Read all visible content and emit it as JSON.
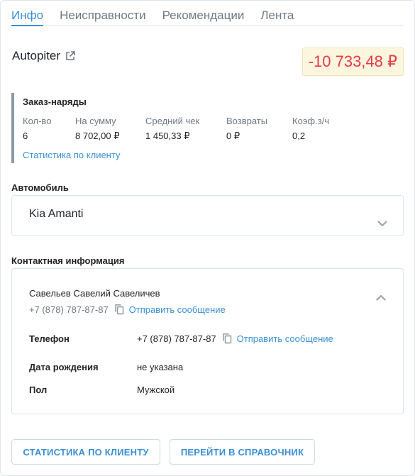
{
  "tabs": [
    {
      "label": "Инфо"
    },
    {
      "label": "Неисправности"
    },
    {
      "label": "Рекомендации"
    },
    {
      "label": "Лента"
    }
  ],
  "client": {
    "name": "Autopiter",
    "balance": "-10 733,48 ₽"
  },
  "orders": {
    "title": "Заказ-наряды",
    "stats": [
      {
        "label": "Кол-во",
        "value": "6"
      },
      {
        "label": "На сумму",
        "value": "8 702,00 ₽"
      },
      {
        "label": "Средний чек",
        "value": "1 450,33 ₽"
      },
      {
        "label": "Возвраты",
        "value": "0 ₽"
      },
      {
        "label": "Коэф.з/ч",
        "value": "0,2"
      }
    ],
    "stats_link": "Статистика по клиенту"
  },
  "car": {
    "title": "Автомобиль",
    "name": "Kia Amanti"
  },
  "contact": {
    "title": "Контактная информация",
    "person_name": "Савельев Савелий Савеличев",
    "person_phone": "+7 (878) 787-87-87",
    "send_message": "Отправить сообщение",
    "phone_label": "Телефон",
    "phone_value": "+7 (878) 787-87-87",
    "birthday_label": "Дата рождения",
    "birthday_value": "не указана",
    "gender_label": "Пол",
    "gender_value": "Мужской"
  },
  "buttons": {
    "client_stats": "СТАТИСТИКА ПО КЛИЕНТУ",
    "go_to_directory": "ПЕРЕЙТИ В СПРАВОЧНИК"
  },
  "colors": {
    "accent": "#3a8fd6",
    "negative": "#e53a47",
    "balance_bg": "#fdf6df"
  },
  "icons": [
    "external-link-icon",
    "chevron-down-icon",
    "chevron-up-icon",
    "copy-icon"
  ]
}
